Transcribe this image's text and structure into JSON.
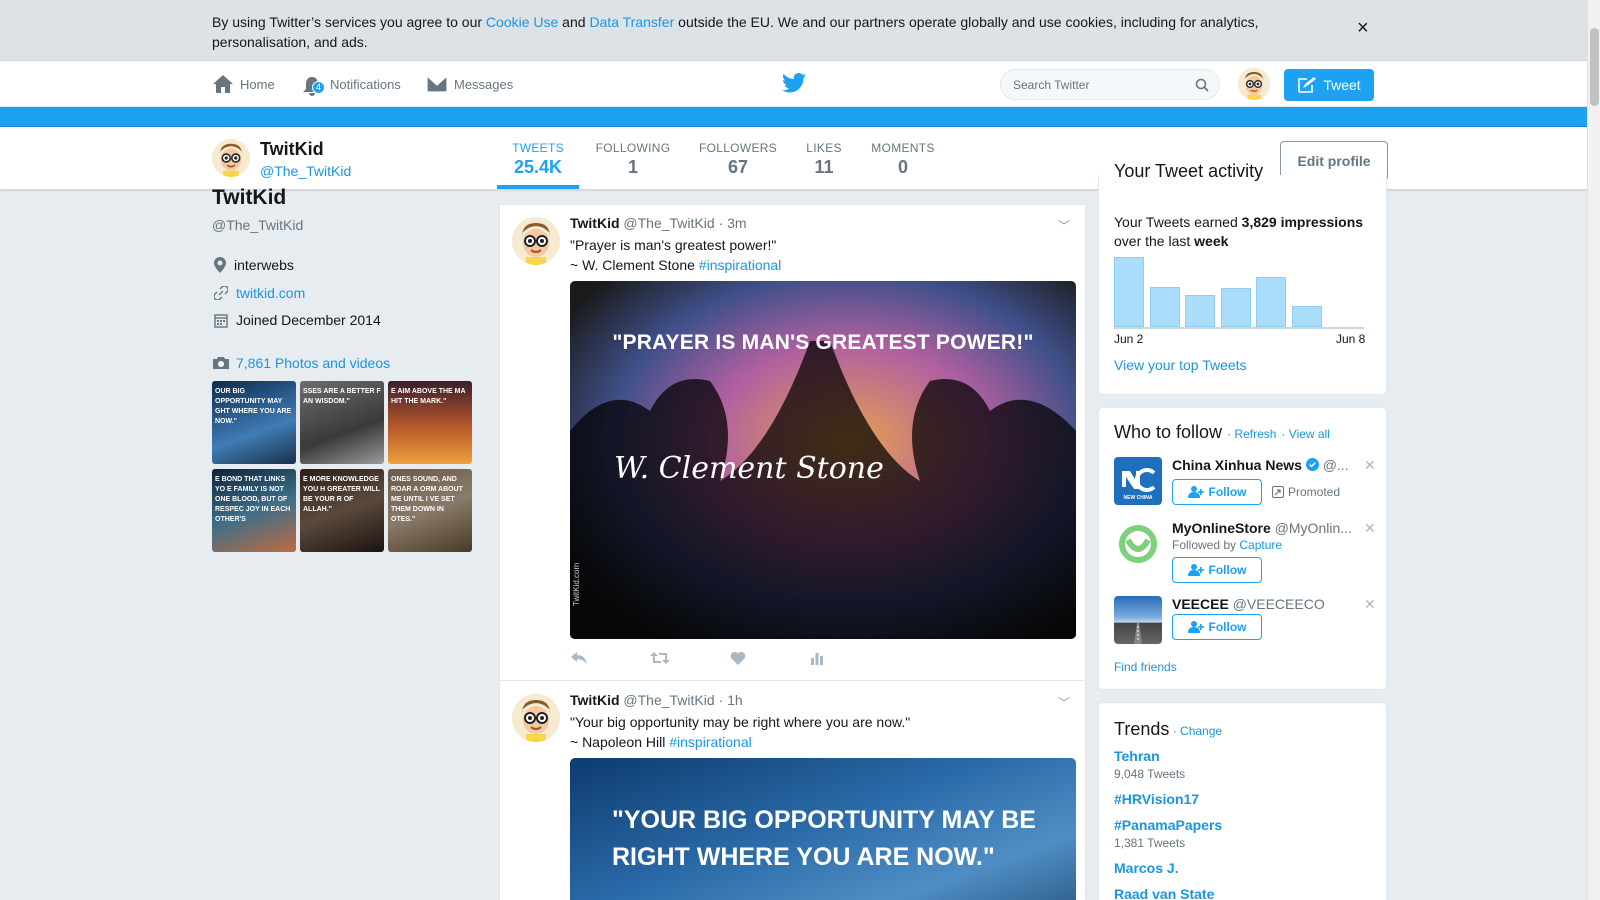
{
  "cookie": {
    "pre": "By using Twitter’s services you agree to our ",
    "cookie_use": "Cookie Use",
    "and": " and ",
    "data_transfer": "Data Transfer",
    "post": " outside the EU. We and our partners operate globally and use cookies, including for analytics, personalisation, and ads.",
    "close": "×"
  },
  "nav": {
    "home": "Home",
    "notifications": "Notifications",
    "notif_count": "4",
    "messages": "Messages",
    "search_placeholder": "Search Twitter",
    "tweet": "Tweet"
  },
  "profile": {
    "name": "TwitKid",
    "handle": "@The_TwitKid",
    "location": "interwebs",
    "website": "twitkid.com",
    "joined": "Joined December 2014",
    "photos": "7,861 Photos and videos",
    "edit": "Edit profile",
    "stats": [
      {
        "label": "TWEETS",
        "value": "25.4K"
      },
      {
        "label": "FOLLOWING",
        "value": "1"
      },
      {
        "label": "FOLLOWERS",
        "value": "67"
      },
      {
        "label": "LIKES",
        "value": "11"
      },
      {
        "label": "MOMENTS",
        "value": "0"
      }
    ]
  },
  "thumbs": [
    "OUR BIG OPPORTUNITY MAY GHT WHERE YOU ARE NOW.\"",
    "SSES ARE A BETTER F AN WISDOM.\"",
    "E AIM ABOVE THE MA HIT THE MARK.\"",
    "E BOND THAT LINKS YO E FAMILY IS NOT ONE BLOOD, BUT OF RESPEC JOY IN EACH OTHER'S",
    "E MORE KNOWLEDGE YOU H GREATER WILL BE YOUR R OF ALLAH.\"",
    "ONES SOUND, AND ROAR A ORM ABOUT ME UNTIL I VE SET THEM DOWN IN OTES.\""
  ],
  "tweets": [
    {
      "name": "TwitKid",
      "handle": "@The_TwitKid",
      "time": "· 3m",
      "line1": "\"Prayer is man's greatest power!\"",
      "line2": "~ W. Clement Stone ",
      "hashtag": "#inspirational",
      "image_text": "\"PRAYER IS MAN'S GREATEST POWER!\"",
      "image_signature": "W. Clement Stone",
      "image_watermark": "TwitKid.com"
    },
    {
      "name": "TwitKid",
      "handle": "@The_TwitKid",
      "time": "· 1h",
      "line1": "\"Your big opportunity may be right where you are now.\"",
      "line2": "~ Napoleon Hill ",
      "hashtag": "#inspirational",
      "image_text_1": "\"YOUR BIG OPPORTUNITY MAY BE",
      "image_text_2": "RIGHT WHERE YOU ARE NOW.\""
    }
  ],
  "activity": {
    "title": "Your Tweet activity",
    "earned_pre": "Your Tweets earned ",
    "impressions": "3,829 impressions",
    "earned_mid": "over the last ",
    "period": "week",
    "start_label": "Jun 2",
    "end_label": "Jun 8",
    "bars": [
      100,
      57,
      45,
      55,
      72,
      30,
      0
    ],
    "link": "View your top Tweets"
  },
  "who_to_follow": {
    "title": "Who to follow",
    "refresh": "Refresh",
    "view_all": "View all",
    "follow": "Follow",
    "accounts": [
      {
        "name": "China Xinhua News",
        "handle": "@...",
        "sub": "Promoted",
        "avatar_text": "NEW CHINA"
      },
      {
        "name": "MyOnlineStore",
        "handle": "@MyOnlin...",
        "sub_pre": "Followed by ",
        "sub_link": "Capture"
      },
      {
        "name": "VEECEE",
        "handle": "@VEECEECO"
      }
    ],
    "find_friends": "Find friends"
  },
  "trends": {
    "title": "Trends",
    "change": "Change",
    "items": [
      {
        "name": "Tehran",
        "count": "9,048 Tweets"
      },
      {
        "name": "#HRVision17",
        "count": ""
      },
      {
        "name": "#PanamaPapers",
        "count": "1,381 Tweets"
      },
      {
        "name": "Marcos J.",
        "count": ""
      },
      {
        "name": "Raad van State",
        "count": ""
      }
    ]
  },
  "colors": {
    "accent": "#1da1f2",
    "link": "#1b95e0"
  }
}
